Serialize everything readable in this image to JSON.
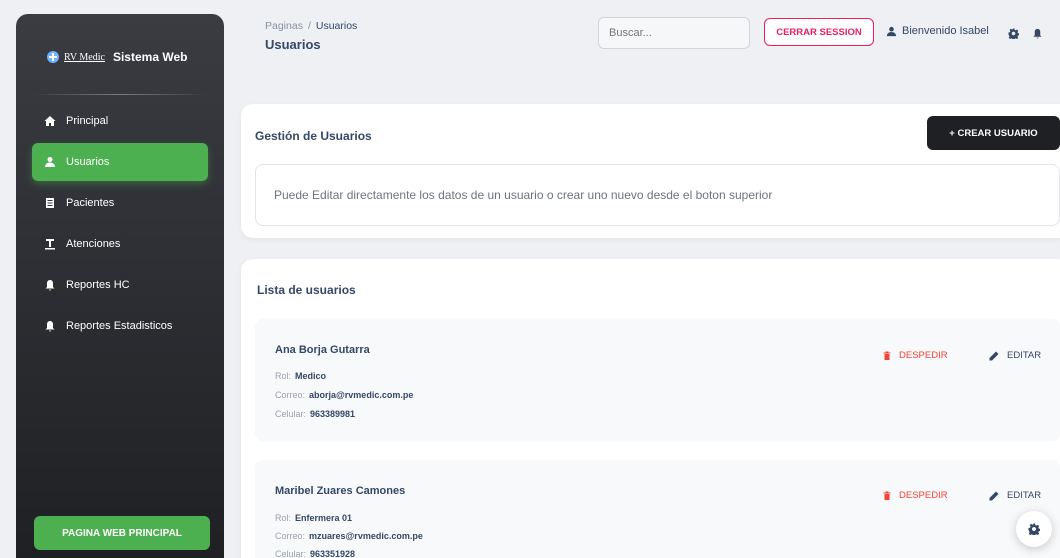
{
  "sidebar": {
    "logo_text": "RV Medic",
    "brand": "Sistema Web",
    "items": [
      {
        "label": "Principal",
        "icon": "home-icon",
        "active": false
      },
      {
        "label": "Usuarios",
        "icon": "user-icon",
        "active": true
      },
      {
        "label": "Pacientes",
        "icon": "clipboard-icon",
        "active": false
      },
      {
        "label": "Atenciones",
        "icon": "medical-icon",
        "active": false
      },
      {
        "label": "Reportes HC",
        "icon": "bell-icon",
        "active": false
      },
      {
        "label": "Reportes Estadisticos",
        "icon": "bell-icon",
        "active": false
      }
    ],
    "footer_button": "PAGINA WEB PRINCIPAL"
  },
  "header": {
    "breadcrumb_root": "Paginas",
    "breadcrumb_sep": "/",
    "breadcrumb_current": "Usuarios",
    "title": "Usuarios",
    "search_placeholder": "Buscar...",
    "logout_label": "CERRAR SESSION",
    "welcome": "Bienvenido Isabel"
  },
  "management": {
    "title": "Gestión de Usuarios",
    "create_button": "+ CREAR USUARIO",
    "info": "Puede Editar directamente los datos de un usuario o crear uno nuevo desde el boton superior"
  },
  "users_list": {
    "title": "Lista de usuarios",
    "role_label": "Rol:",
    "email_label": "Correo:",
    "phone_label": "Celular:",
    "fire_label": "DESPEDIR",
    "edit_label": "EDITAR",
    "users": [
      {
        "name": "Ana Borja Gutarra",
        "role": "Medico",
        "email": "aborja@rvmedic.com.pe",
        "phone": "963389981"
      },
      {
        "name": "Maribel Zuares Camones",
        "role": "Enfermera 01",
        "email": "mzuares@rvmedic.com.pe",
        "phone": "963351928"
      }
    ]
  },
  "colors": {
    "accent_green": "#4caf50",
    "danger": "#f44335",
    "logout_pink": "#e91e63",
    "dark": "#1f2023"
  }
}
